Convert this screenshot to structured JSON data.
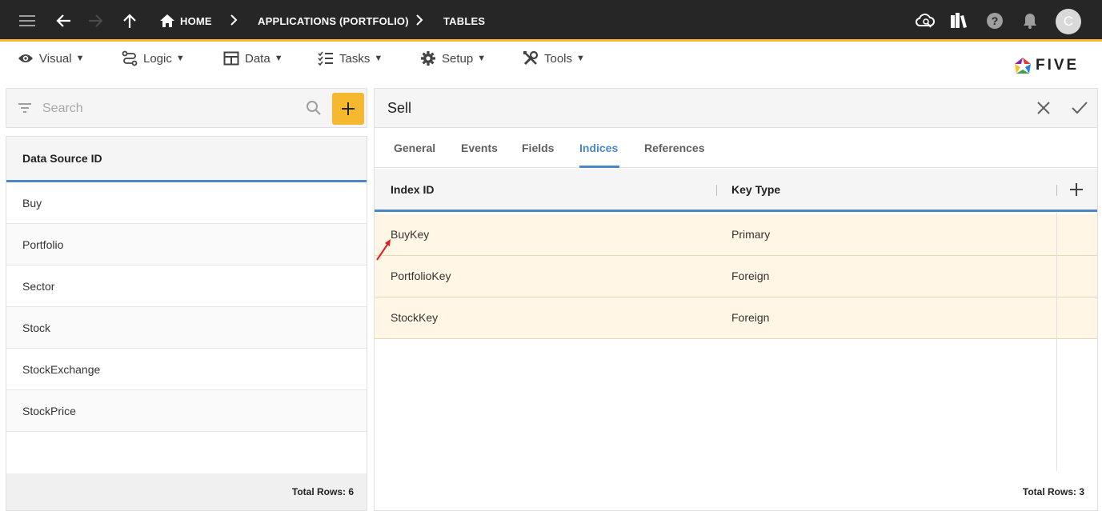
{
  "appbar": {
    "breadcrumbs": [
      "HOME",
      "APPLICATIONS (PORTFOLIO)",
      "TABLES"
    ],
    "avatar_initial": "C",
    "accent": "#f5b82e",
    "icons": [
      "menu-icon",
      "back-arrow-icon",
      "forward-arrow-icon",
      "up-arrow-icon",
      "home-icon",
      "cloud-sync-icon",
      "library-icon",
      "help-icon",
      "notifications-icon"
    ]
  },
  "menubar": {
    "items": [
      "Visual",
      "Logic",
      "Data",
      "Tasks",
      "Setup",
      "Tools"
    ],
    "caret": "▼",
    "logo_text": "FIVE"
  },
  "left": {
    "search_placeholder": "Search",
    "column_header": "Data Source ID",
    "rows": [
      "Buy",
      "Portfolio",
      "Sector",
      "Stock",
      "StockExchange",
      "StockPrice"
    ],
    "footer": "Total Rows: 6"
  },
  "form": {
    "title": "Sell",
    "tabs": [
      "General",
      "Events",
      "Fields",
      "Indices",
      "References"
    ],
    "active_tab": "Indices",
    "columns": [
      "Index ID",
      "Key Type"
    ],
    "rows": [
      {
        "index_id": "BuyKey",
        "key_type": "Primary"
      },
      {
        "index_id": "PortfolioKey",
        "key_type": "Foreign"
      },
      {
        "index_id": "StockKey",
        "key_type": "Foreign"
      }
    ],
    "footer": "Total Rows: 3"
  }
}
